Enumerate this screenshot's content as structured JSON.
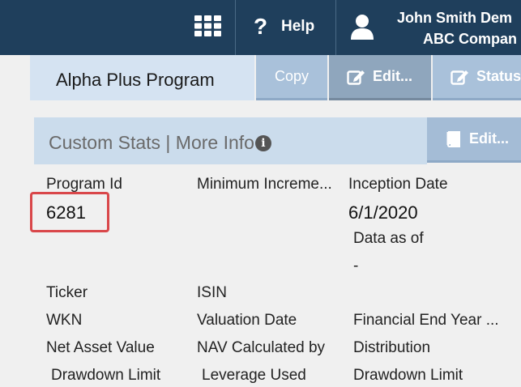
{
  "topbar": {
    "apps_icon": "grid-apps-icon",
    "help_icon": "question-mark-icon",
    "help_label": "Help",
    "user_icon": "user-icon",
    "user_name": "John Smith Dem",
    "user_company": "ABC Compan",
    "background": "#1f3f5c"
  },
  "program": {
    "title": "Alpha Plus Program",
    "copy_label": "Copy",
    "edit_label": "Edit...",
    "status_label": "Status"
  },
  "section": {
    "title": "Custom Stats | More Info",
    "edit_label": "Edit..."
  },
  "fields": {
    "program_id_label": "Program Id",
    "program_id_value": "6281",
    "min_increment_label": "Minimum Increme...",
    "inception_date_label": "Inception Date",
    "inception_date_value": "6/1/2020",
    "data_as_of_label": "Data as of",
    "data_as_of_value": "-",
    "ticker_label": "Ticker",
    "isin_label": "ISIN",
    "wkn_label": "WKN",
    "valuation_date_label": "Valuation Date",
    "financial_end_year_label": "Financial End Year ...",
    "nav_label": "Net Asset Value",
    "nav_calc_label": "NAV Calculated by",
    "distribution_label": "Distribution",
    "drawdown_limit_label_1": "Drawdown Limit",
    "leverage_used_label": "Leverage Used",
    "drawdown_limit_label_2": "Drawdown Limit"
  },
  "colors": {
    "highlight_border": "#d9474a",
    "header_panel": "#d5e3f2"
  }
}
